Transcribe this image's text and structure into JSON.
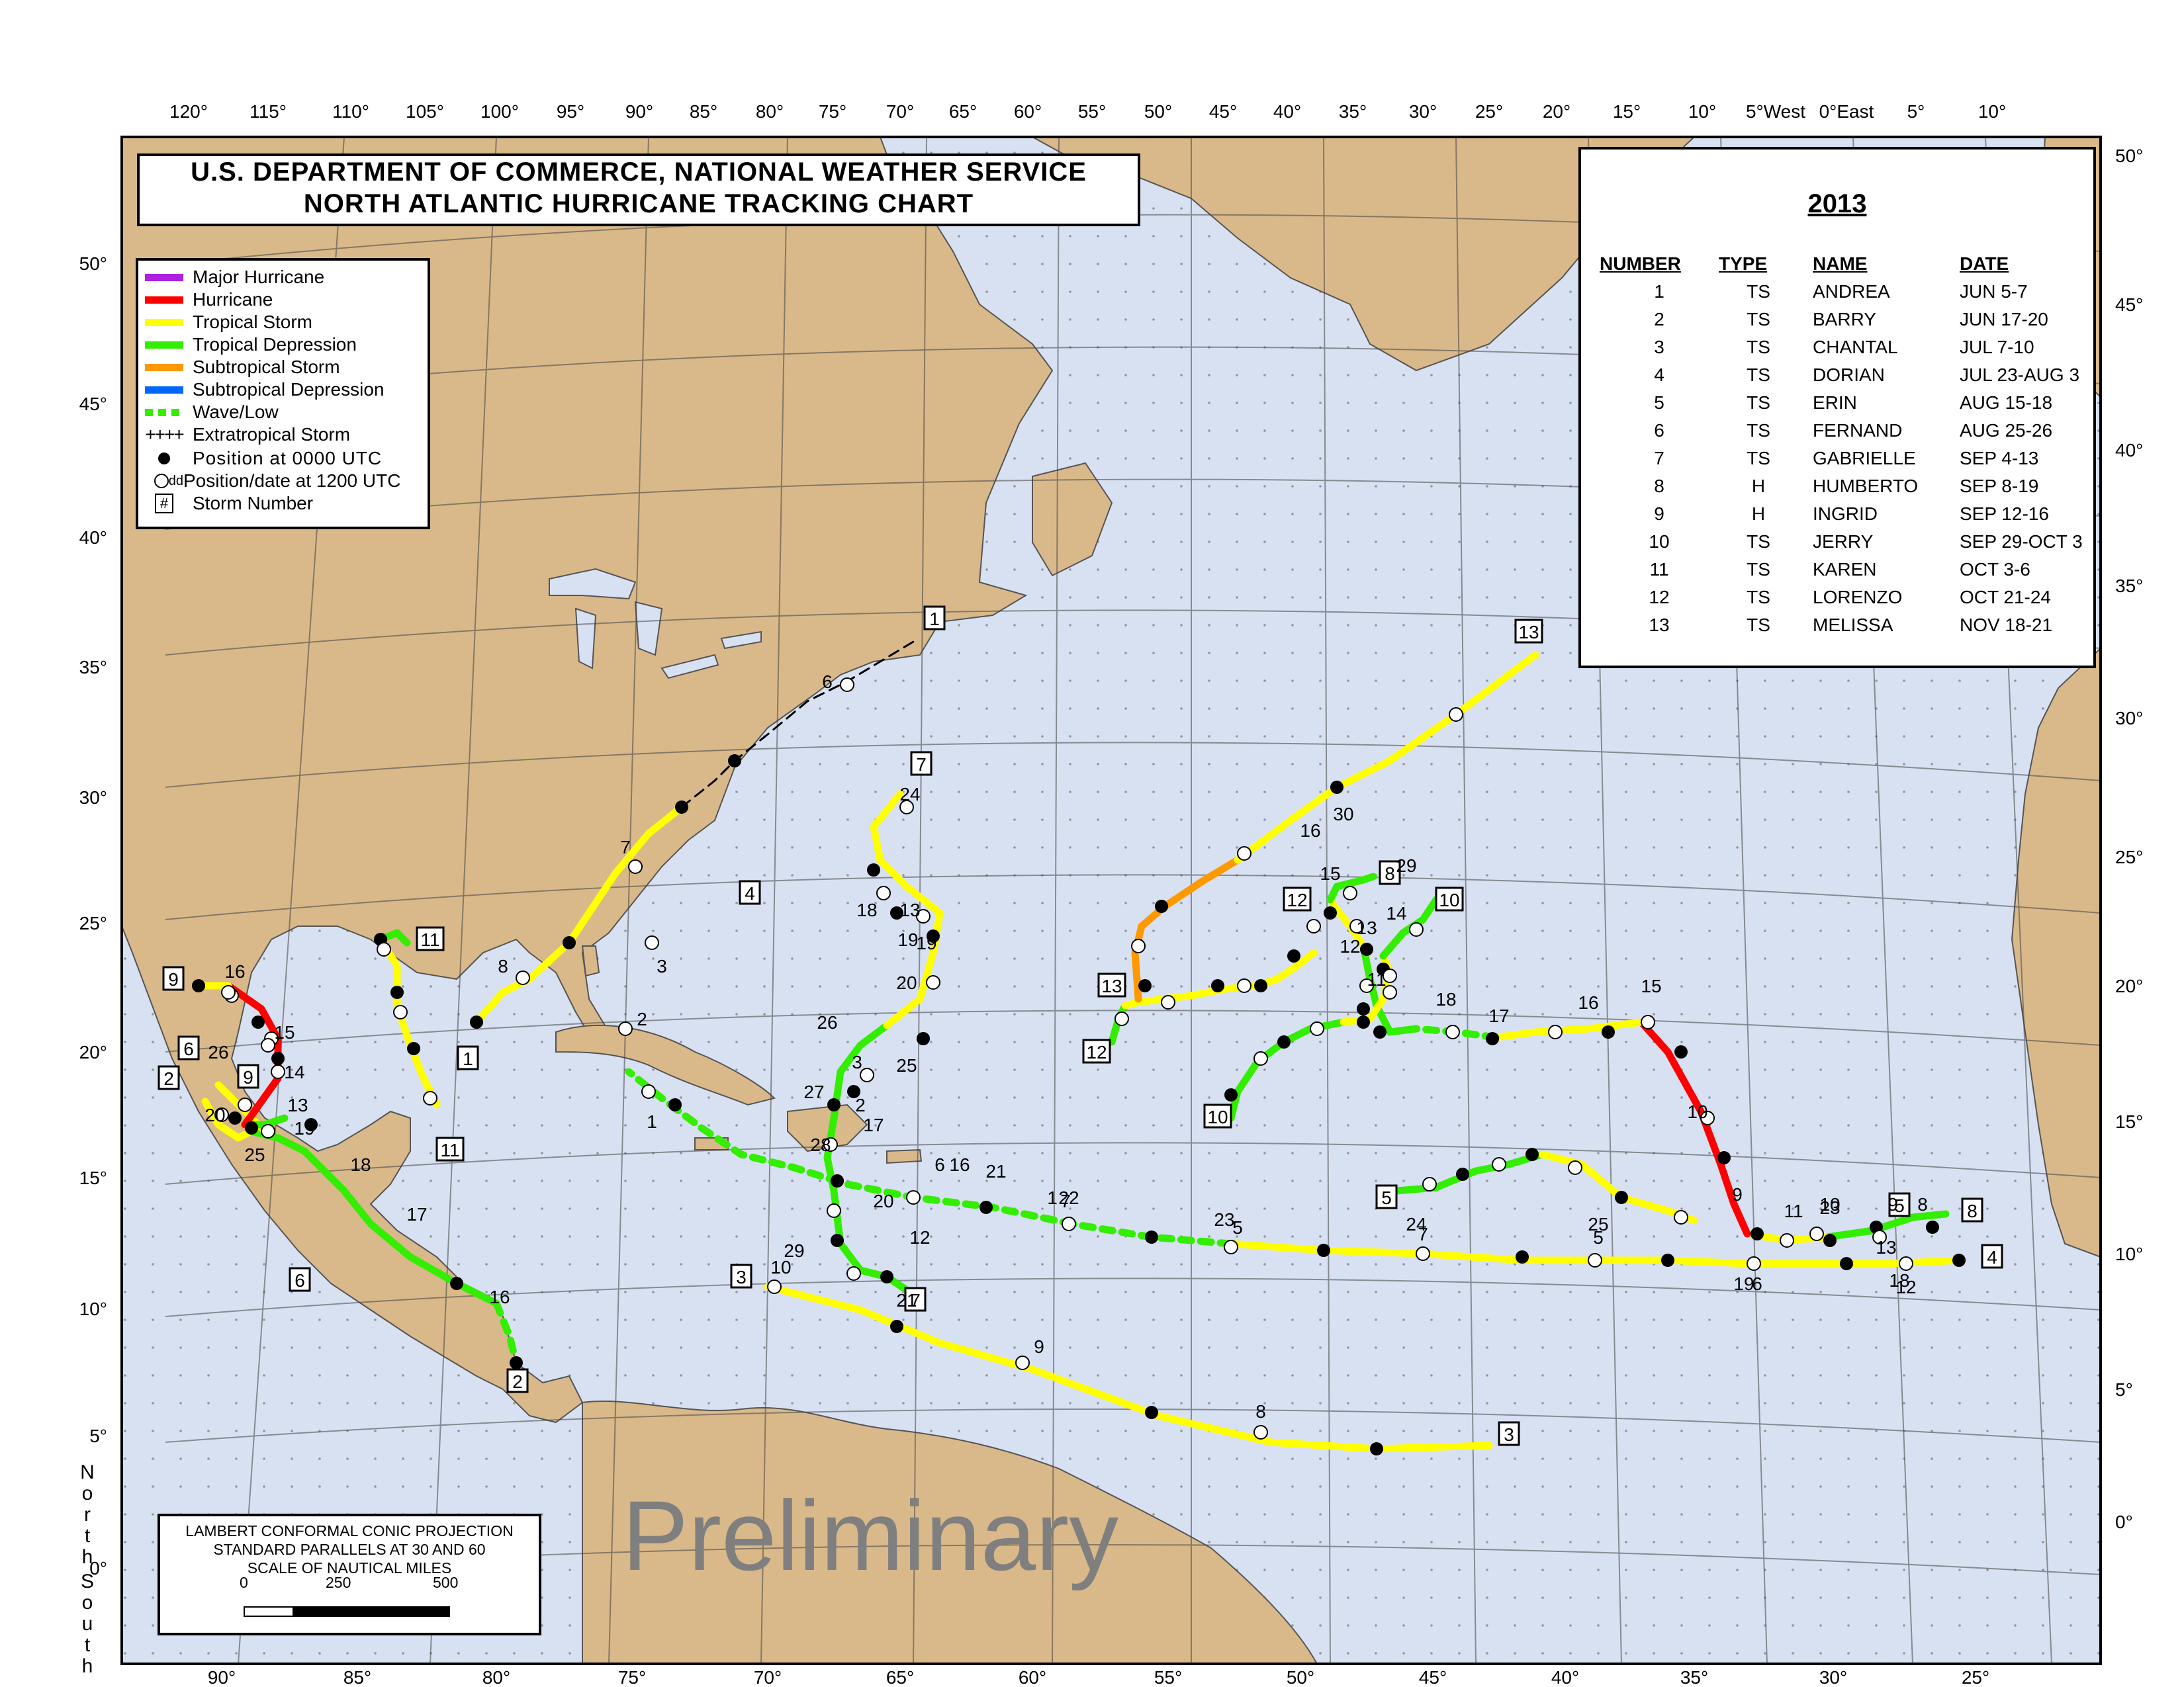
{
  "header": {
    "line1": "U.S. DEPARTMENT OF COMMERCE, NATIONAL WEATHER SERVICE",
    "line2": "NORTH ATLANTIC HURRICANE TRACKING CHART"
  },
  "legend": {
    "items": [
      {
        "label": "Major Hurricane",
        "color": "#b020e0",
        "style": "solid"
      },
      {
        "label": "Hurricane",
        "color": "#ff0000",
        "style": "solid"
      },
      {
        "label": "Tropical Storm",
        "color": "#ffff00",
        "style": "solid"
      },
      {
        "label": "Tropical Depression",
        "color": "#33ee00",
        "style": "solid"
      },
      {
        "label": "Subtropical Storm",
        "color": "#ff9900",
        "style": "solid"
      },
      {
        "label": "Subtropical Depression",
        "color": "#0066ff",
        "style": "solid"
      },
      {
        "label": "Wave/Low",
        "color": "#33ee00",
        "style": "dashed"
      },
      {
        "label": "Extratropical Storm",
        "color": "#000000",
        "style": "plus"
      }
    ],
    "pos0000": "Position at 0000 UTC",
    "pos1200_sup": "dd",
    "pos1200": "Position/date at 1200 UTC",
    "storm_number_symbol": "#",
    "storm_number": "Storm Number"
  },
  "season": {
    "year": "2013",
    "headers": [
      "NUMBER",
      "TYPE",
      "NAME",
      "DATE"
    ],
    "storms": [
      {
        "number": "1",
        "type": "TS",
        "name": "ANDREA",
        "date": "JUN  5-7"
      },
      {
        "number": "2",
        "type": "TS",
        "name": "BARRY",
        "date": "JUN 17-20"
      },
      {
        "number": "3",
        "type": "TS",
        "name": "CHANTAL",
        "date": "JUL  7-10"
      },
      {
        "number": "4",
        "type": "TS",
        "name": "DORIAN",
        "date": "JUL 23-AUG 3"
      },
      {
        "number": "5",
        "type": "TS",
        "name": "ERIN",
        "date": "AUG 15-18"
      },
      {
        "number": "6",
        "type": "TS",
        "name": "FERNAND",
        "date": "AUG 25-26"
      },
      {
        "number": "7",
        "type": "TS",
        "name": "GABRIELLE",
        "date": "SEP  4-13"
      },
      {
        "number": "8",
        "type": "H",
        "name": "HUMBERTO",
        "date": "SEP  8-19"
      },
      {
        "number": "9",
        "type": "H",
        "name": "INGRID",
        "date": "SEP 12-16"
      },
      {
        "number": "10",
        "type": "TS",
        "name": "JERRY",
        "date": "SEP 29-OCT 3"
      },
      {
        "number": "11",
        "type": "TS",
        "name": "KAREN",
        "date": "OCT  3-6"
      },
      {
        "number": "12",
        "type": "TS",
        "name": "LORENZO",
        "date": "OCT 21-24"
      },
      {
        "number": "13",
        "type": "TS",
        "name": "MELISSA",
        "date": "NOV 18-21"
      }
    ]
  },
  "projection": {
    "line1": "LAMBERT CONFORMAL CONIC PROJECTION",
    "line2": "STANDARD PARALLELS AT 30  AND 60",
    "line3": "SCALE OF NAUTICAL MILES",
    "scale_labels": [
      "0",
      "250",
      "500"
    ]
  },
  "watermark": "Preliminary",
  "hemisphere_labels": {
    "north": "North",
    "south": "South"
  },
  "axes": {
    "top": [
      "120°",
      "115°",
      "110°",
      "105°",
      "100°",
      "95°",
      "90°",
      "85°",
      "80°",
      "75°",
      "70°",
      "65°",
      "60°",
      "55°",
      "50°",
      "45°",
      "40°",
      "35°",
      "30°",
      "25°",
      "20°",
      "15°",
      "10°",
      "5°West",
      "0°East",
      "5°",
      "10°"
    ],
    "bottom": [
      "90°",
      "85°",
      "80°",
      "75°",
      "70°",
      "65°",
      "60°",
      "55°",
      "50°",
      "45°",
      "40°",
      "35°",
      "30°",
      "25°"
    ],
    "left": [
      "50°",
      "45°",
      "40°",
      "35°",
      "30°",
      "25°",
      "20°",
      "15°",
      "10°",
      "5°",
      "0°"
    ],
    "right": [
      "50°",
      "45°",
      "40°",
      "35°",
      "30°",
      "25°",
      "20°",
      "15°",
      "10°",
      "5°",
      "0°"
    ]
  },
  "colors": {
    "ocean": "#d8e1f2",
    "land": "#d9b98a",
    "hurricane": "#ff0000",
    "tropical_storm": "#ffff00",
    "tropical_depression": "#33ee00",
    "subtropical_storm": "#ff9900"
  },
  "track_labels": {
    "storm_numbers": [
      "1",
      "1",
      "2",
      "2",
      "3",
      "3",
      "4",
      "4",
      "5",
      "5",
      "6",
      "6",
      "7",
      "7",
      "8",
      "8",
      "9",
      "9",
      "10",
      "10",
      "11",
      "11",
      "12",
      "12",
      "13",
      "13"
    ],
    "dates": [
      "6",
      "7",
      "8",
      "1",
      "2",
      "3",
      "16",
      "15",
      "14",
      "13",
      "19",
      "20",
      "25",
      "26",
      "18",
      "17",
      "16",
      "10",
      "9",
      "8",
      "6",
      "7",
      "5",
      "7",
      "5",
      "6",
      "12",
      "13",
      "11",
      "10",
      "9",
      "8",
      "29",
      "28",
      "27",
      "26",
      "25",
      "24",
      "23",
      "9",
      "10",
      "15",
      "16",
      "17",
      "18",
      "11",
      "12",
      "13",
      "14",
      "15",
      "16",
      "17",
      "18",
      "19",
      "20",
      "21",
      "22",
      "23",
      "24",
      "25",
      "19",
      "18",
      "3",
      "2",
      "1",
      "16",
      "30",
      "29",
      "12",
      "21",
      "20",
      "19",
      "13"
    ]
  }
}
